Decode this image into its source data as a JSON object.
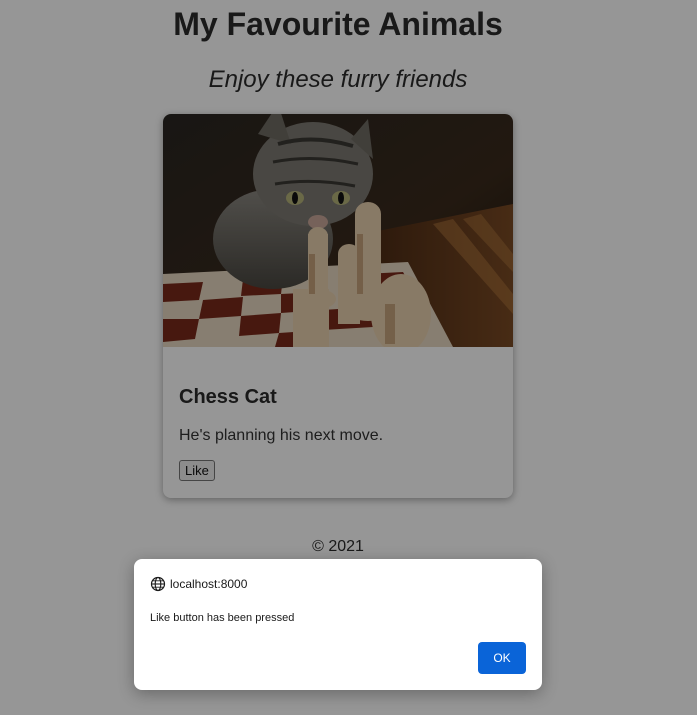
{
  "page": {
    "title": "My Favourite Animals",
    "subtitle": "Enjoy these furry friends",
    "footer": "© 2021"
  },
  "card": {
    "image_subject": "tabby cat looking over chess pieces on a chessboard",
    "title": "Chess Cat",
    "description": "He's planning his next move.",
    "like_label": "Like"
  },
  "dialog": {
    "origin": "localhost:8000",
    "message": "Like button has been pressed",
    "ok_label": "OK",
    "icon": "globe-icon"
  },
  "colors": {
    "overlay": "#000000",
    "ok_button": "#0a64d8",
    "text": "#2b2b2b"
  }
}
